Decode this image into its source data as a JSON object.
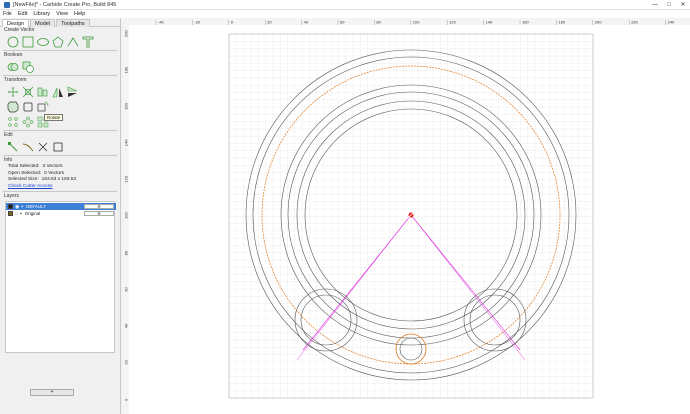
{
  "window": {
    "title": "[NewFile]* - Carbide Create Pro, Build 845",
    "minimize": "—",
    "maximize": "□",
    "close": "✕"
  },
  "menu": [
    "File",
    "Edit",
    "Library",
    "View",
    "Help"
  ],
  "tabs": [
    "Design",
    "Model",
    "Toolpaths"
  ],
  "sections": {
    "create_vector": "Create Vector",
    "boolean": "Boolean",
    "transform": "Transform",
    "edit": "Edit",
    "info": "Info",
    "layers": "Layers"
  },
  "tooltip": "Rotate",
  "info": {
    "total_selected_label": "Total Selected:",
    "total_selected_value": "3 Vectors",
    "open_selected_label": "Open Selected:",
    "open_selected_value": "0 Vectors",
    "selected_size_label": "Selected Size:",
    "selected_size_value": "163.53 x 163.53",
    "check_cutter": "Check Cutter Access"
  },
  "layers": [
    {
      "name": "DEFAULT",
      "color": "#1a1a1a",
      "selected": true,
      "gear": "⚙"
    },
    {
      "name": "Original",
      "color": "#7a6a1a",
      "selected": false,
      "gear": "⚙"
    }
  ],
  "add_layer": "+",
  "ruler": {
    "x_labels": [
      "-40",
      "-20",
      "0",
      "20",
      "40",
      "60",
      "80",
      "100",
      "120",
      "140",
      "160",
      "180",
      "200",
      "220",
      "240"
    ],
    "y_labels": [
      "200",
      "180",
      "160",
      "140",
      "120",
      "100",
      "80",
      "60",
      "40",
      "20",
      "0"
    ]
  },
  "colors": {
    "accent": "#3d7fd6",
    "toolpath_orange": "#e07a20",
    "construction_magenta": "#e040e0",
    "origin_red": "#e02020",
    "icon_green": "#3a9a3a"
  }
}
